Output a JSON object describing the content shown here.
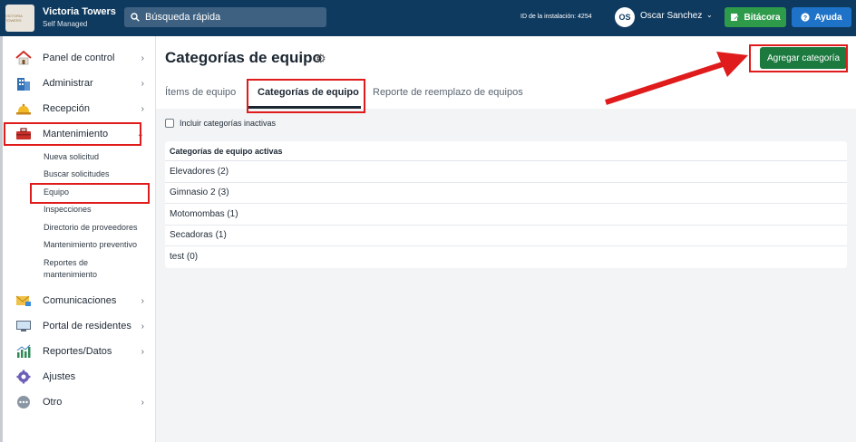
{
  "header": {
    "app_title": "Victoria Towers",
    "app_subtitle": "Self Managed",
    "logo_text": "VICTORIA TOWERS",
    "search_placeholder": "Búsqueda rápida",
    "installation_id": "ID de la instalación: 4254",
    "user_initials": "OS",
    "user_name": "Oscar Sanchez",
    "bitacora_label": "Bitácora",
    "ayuda_label": "Ayuda"
  },
  "sidebar": {
    "items": [
      {
        "label": "Panel de control",
        "icon": "house-icon"
      },
      {
        "label": "Administrar",
        "icon": "building-icon"
      },
      {
        "label": "Recepción",
        "icon": "bell-icon"
      },
      {
        "label": "Mantenimiento",
        "icon": "toolbox-icon"
      },
      {
        "label": "Comunicaciones",
        "icon": "mail-icon"
      },
      {
        "label": "Portal de residentes",
        "icon": "monitor-icon"
      },
      {
        "label": "Reportes/Datos",
        "icon": "bar-chart-icon"
      },
      {
        "label": "Ajustes",
        "icon": "gear-icon"
      },
      {
        "label": "Otro",
        "icon": "more-icon"
      }
    ],
    "sub_items": [
      "Nueva solicitud",
      "Buscar solicitudes",
      "Equipo",
      "Inspecciones",
      "Directorio de proveedores",
      "Mantenimiento preventivo",
      "Reportes de",
      "mantenimiento"
    ]
  },
  "main": {
    "title": "Categorías de equipo",
    "add_button": "Agregar categoría",
    "tabs": [
      {
        "label": "Ítems de equipo"
      },
      {
        "label": "Categorías de equipo"
      },
      {
        "label": "Reporte de reemplazo de equipos"
      }
    ],
    "include_inactive_label": "Incluir categorías inactivas",
    "table_header": "Categorías de equipo activas",
    "rows": [
      "Elevadores (2)",
      "Gimnasio 2 (3)",
      "Motomombas (1)",
      "Secadoras (1)",
      "test (0)"
    ]
  },
  "colors": {
    "topbar": "#0f3a5f",
    "accent_green": "#1c7a3f",
    "highlight_red": "#e01b1b"
  }
}
